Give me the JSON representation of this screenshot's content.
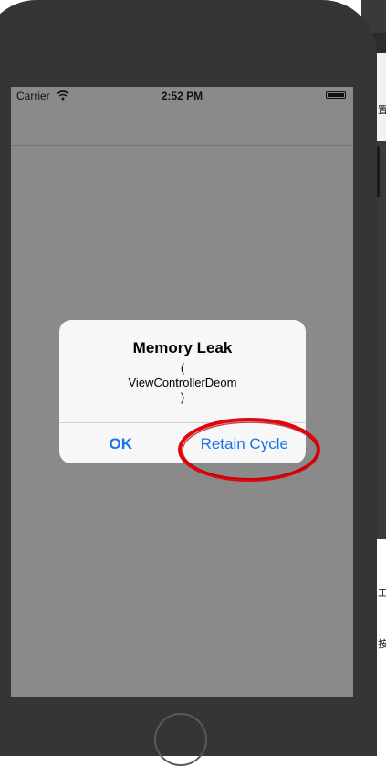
{
  "status_bar": {
    "carrier": "Carrier",
    "time": "2:52 PM",
    "wifi_icon": "wifi-icon",
    "battery_icon": "battery-icon"
  },
  "alert": {
    "title": "Memory Leak",
    "message_lines": [
      "(",
      "ViewControllerDeom",
      ")"
    ],
    "buttons": {
      "ok": "OK",
      "retain_cycle": "Retain Cycle"
    }
  },
  "background_window": {
    "glyphs": [
      "置",
      "工",
      "按"
    ]
  },
  "colors": {
    "alert_button": "#1a73e8",
    "annotation": "#e0060b",
    "dim_overlay": "#8a8a8a"
  }
}
